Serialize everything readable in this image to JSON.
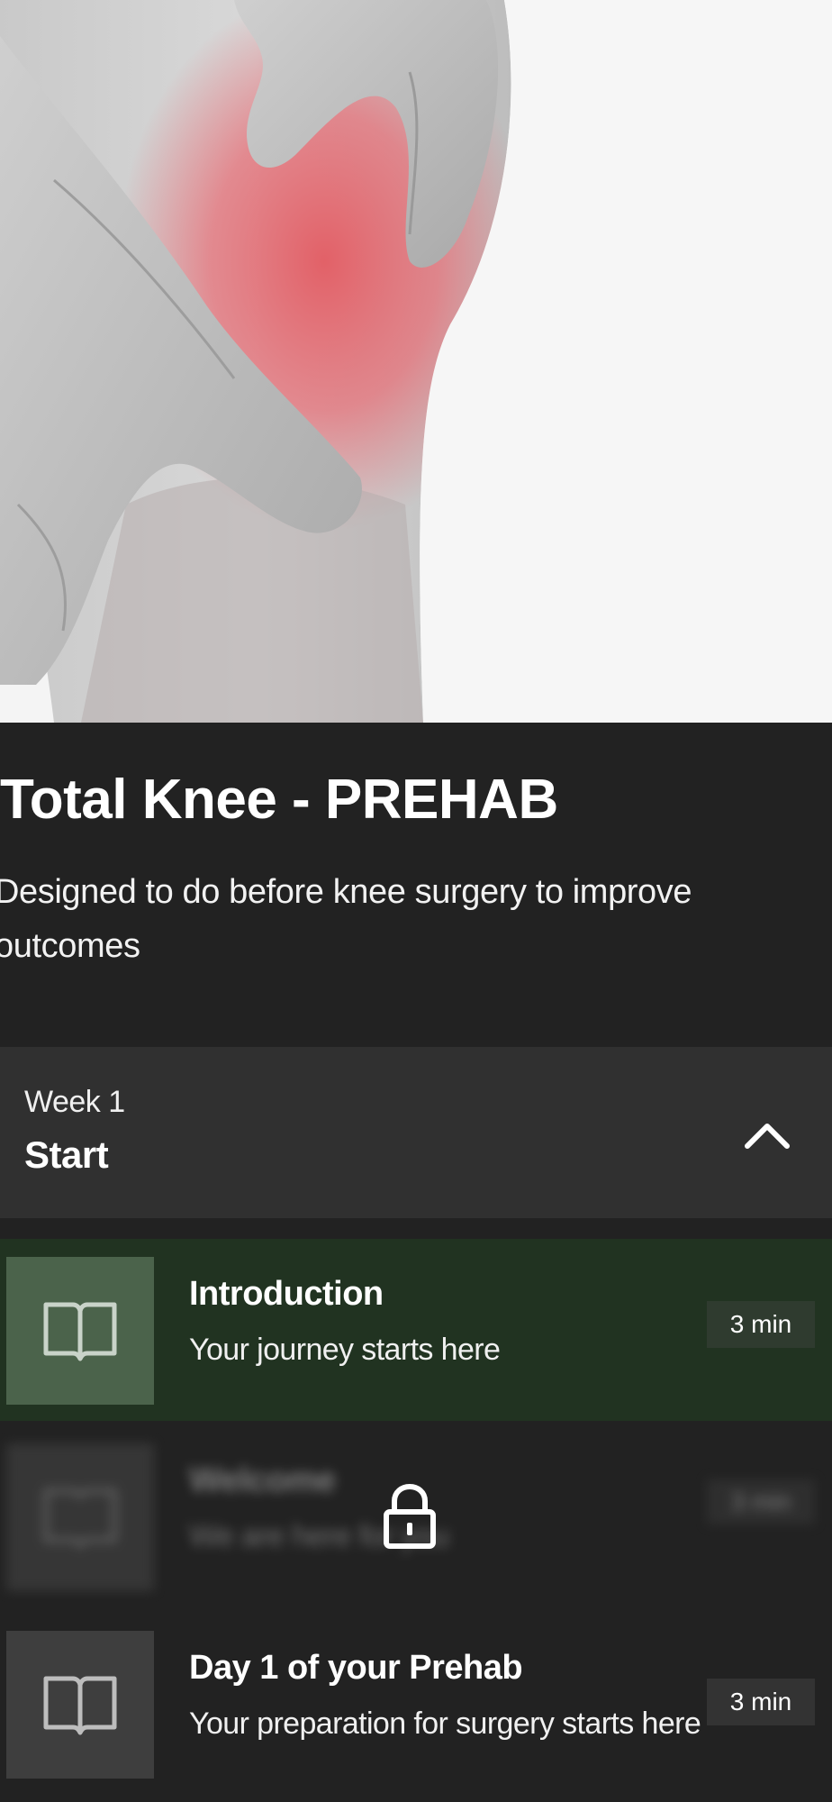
{
  "program": {
    "title": "Total Knee - PREHAB",
    "description": "Designed to do before knee surgery to improve outcomes"
  },
  "week": {
    "label": "Week 1",
    "title": "Start",
    "expanded": true
  },
  "lessons": [
    {
      "title": "Introduction",
      "subtitle": "Your journey starts here",
      "duration": "3 min",
      "icon": "book-icon",
      "state": "active"
    },
    {
      "title": "Welcome",
      "subtitle": "We are here for you",
      "duration": "3 min",
      "icon": "book-icon",
      "state": "locked"
    },
    {
      "title": "Day 1 of your Prehab",
      "subtitle": "Your preparation for surgery starts here",
      "duration": "3 min",
      "icon": "book-icon",
      "state": "normal"
    }
  ],
  "colors": {
    "background": "#222222",
    "week_header": "#303030",
    "active_lesson": "#213321",
    "pain_highlight": "#e35b62"
  }
}
